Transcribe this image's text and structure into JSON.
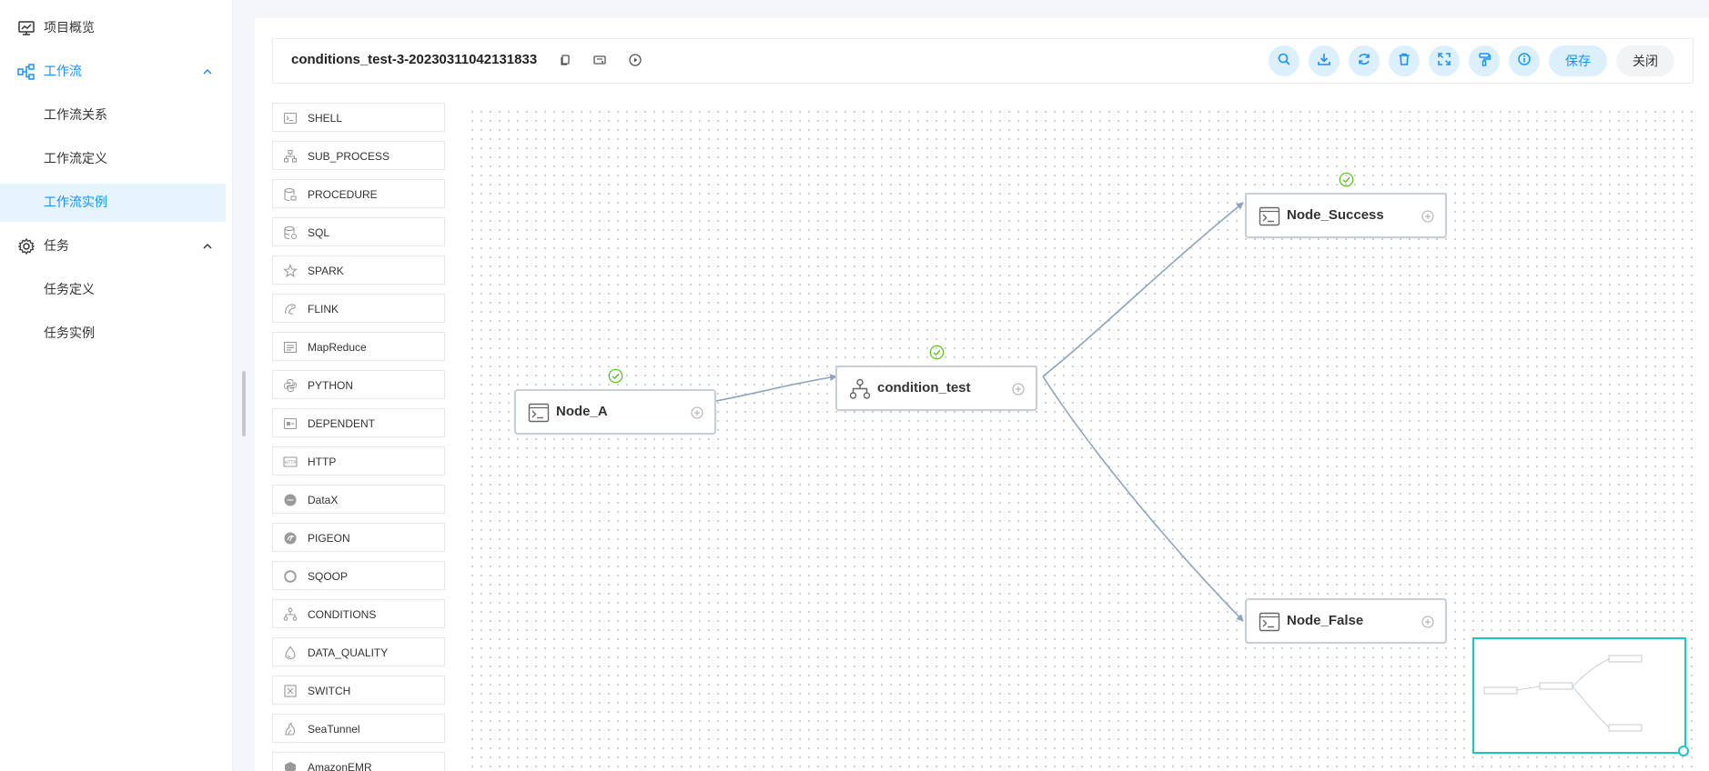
{
  "sidebar": {
    "items": [
      {
        "label": "项目概览",
        "icon": "monitor-chart-icon"
      },
      {
        "label": "工作流",
        "icon": "workflow-icon",
        "expanded": true
      },
      {
        "label": "工作流关系"
      },
      {
        "label": "工作流定义"
      },
      {
        "label": "工作流实例",
        "selected": true
      },
      {
        "label": "任务",
        "icon": "gear-icon",
        "expanded": true
      },
      {
        "label": "任务定义"
      },
      {
        "label": "任务实例"
      }
    ]
  },
  "toolbar": {
    "title": "conditions_test-3-20230311042131833",
    "save_label": "保存",
    "close_label": "关闭",
    "buttons": [
      "search-icon",
      "download-icon",
      "refresh-icon",
      "delete-icon",
      "fullscreen-icon",
      "format-brush-icon",
      "info-icon"
    ]
  },
  "palette": {
    "items": [
      "SHELL",
      "SUB_PROCESS",
      "PROCEDURE",
      "SQL",
      "SPARK",
      "FLINK",
      "MapReduce",
      "PYTHON",
      "DEPENDENT",
      "HTTP",
      "DataX",
      "PIGEON",
      "SQOOP",
      "CONDITIONS",
      "DATA_QUALITY",
      "SWITCH",
      "SeaTunnel",
      "AmazonEMR"
    ]
  },
  "dag": {
    "nodes": [
      {
        "name": "Node_A",
        "type": "shell",
        "status": "success"
      },
      {
        "name": "condition_test",
        "type": "conditions",
        "status": "success"
      },
      {
        "name": "Node_Success",
        "type": "shell",
        "status": "success"
      },
      {
        "name": "Node_False",
        "type": "shell",
        "status": "none"
      }
    ],
    "edges": [
      [
        "Node_A",
        "condition_test"
      ],
      [
        "condition_test",
        "Node_Success"
      ],
      [
        "condition_test",
        "Node_False"
      ]
    ]
  },
  "colors": {
    "accent": "#1890ff",
    "success": "#52c41a",
    "minimap_border": "#19c6c6",
    "edge": "#8ea3be"
  }
}
